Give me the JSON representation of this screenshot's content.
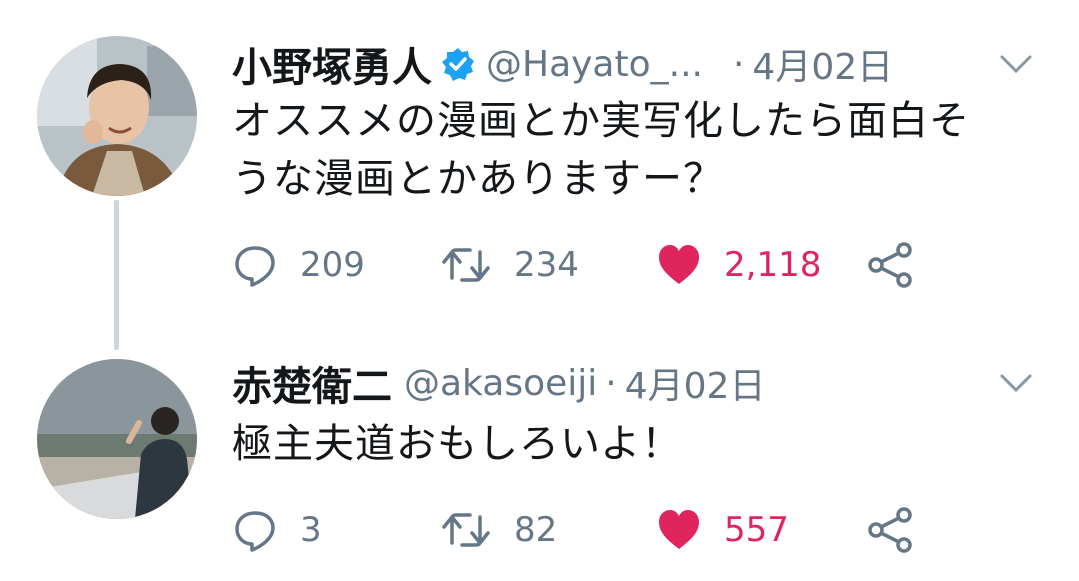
{
  "tweets": [
    {
      "name": "小野塚勇人",
      "handle": "@Hayato_...",
      "separator": "·",
      "time": "4月02日",
      "text_line1": "オススメの漫画とか実写化したら面白そ",
      "text_line2": "うな漫画とかありますー？",
      "replies": "209",
      "retweets": "234",
      "likes": "2,118",
      "verified_icon": "verified-badge-icon"
    },
    {
      "name": "赤楚衛二",
      "handle": "@akasoeiji",
      "separator": "·",
      "time": "4月02日",
      "text_line1": "極主夫道おもしろいよ！",
      "replies": "3",
      "retweets": "82",
      "likes": "557"
    }
  ],
  "colors": {
    "like": "#e0245e",
    "verified": "#1da1f2",
    "muted": "#657786",
    "text": "#14171a",
    "thread_line": "#ccd6dd"
  },
  "icons": [
    "reply-icon",
    "retweet-icon",
    "like-icon",
    "share-icon",
    "chevron-down-icon"
  ]
}
